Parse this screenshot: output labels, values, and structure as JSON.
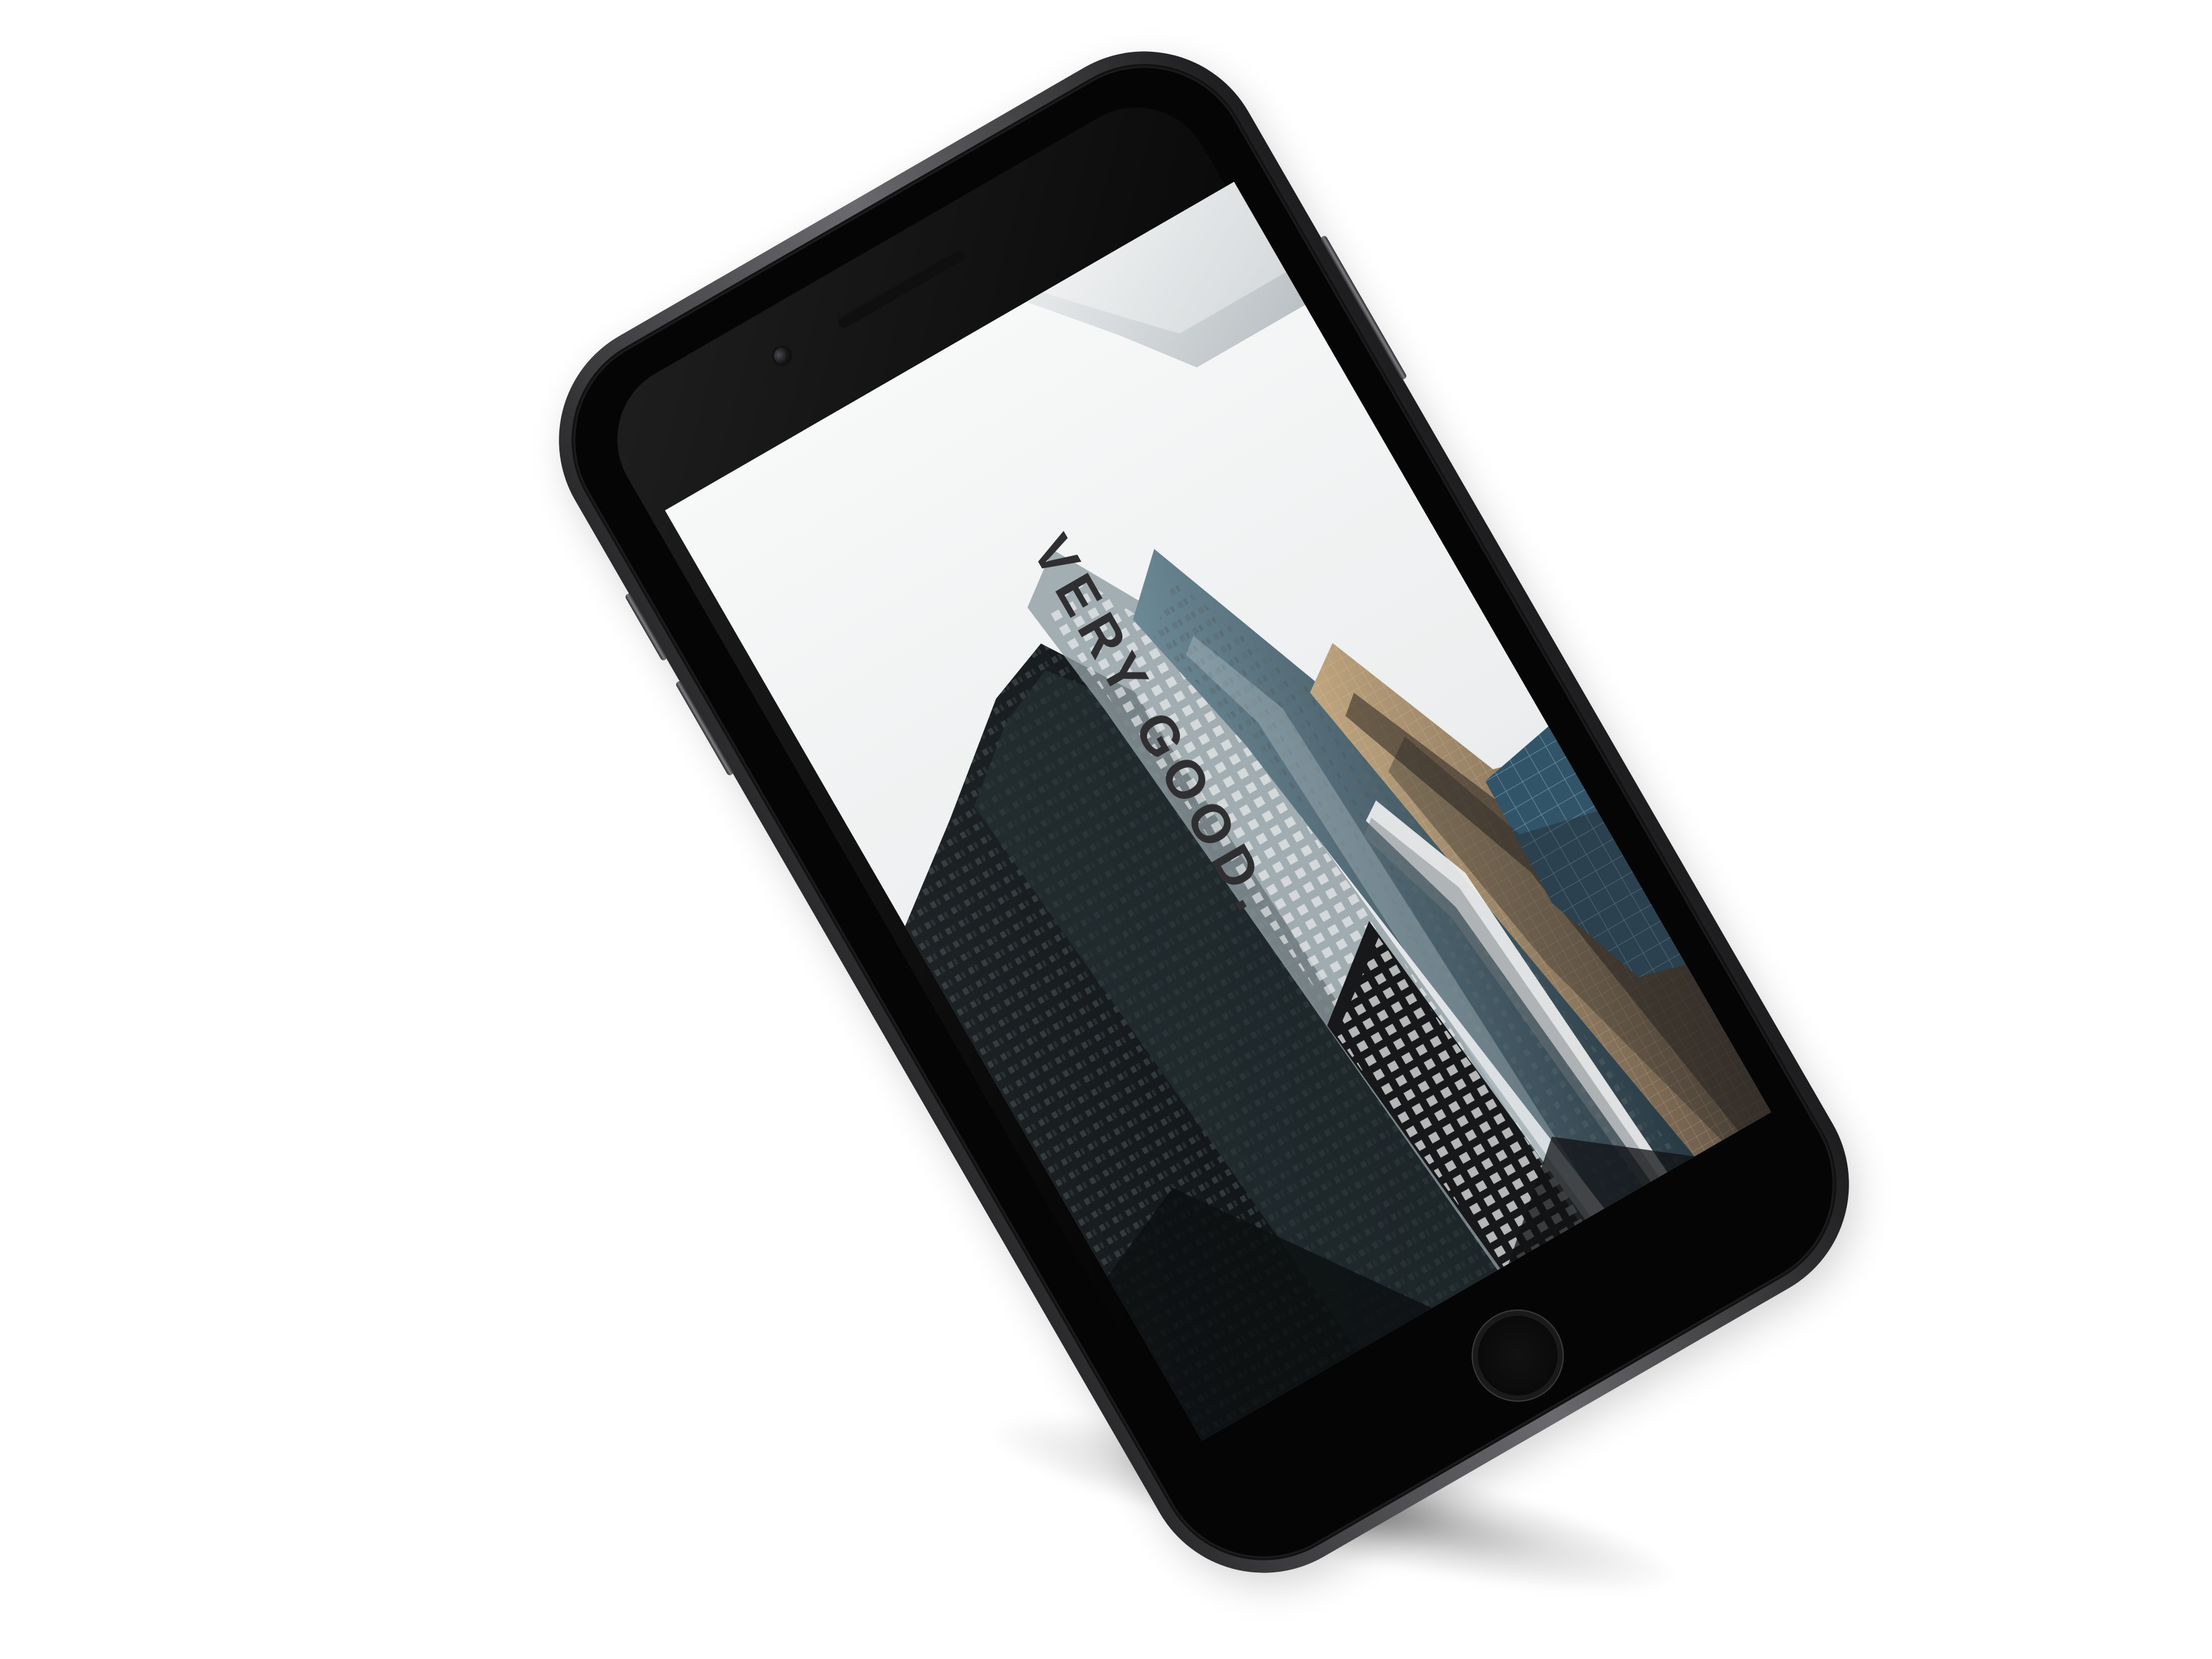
{
  "headline": {
    "text": "VERY GOOD."
  }
}
